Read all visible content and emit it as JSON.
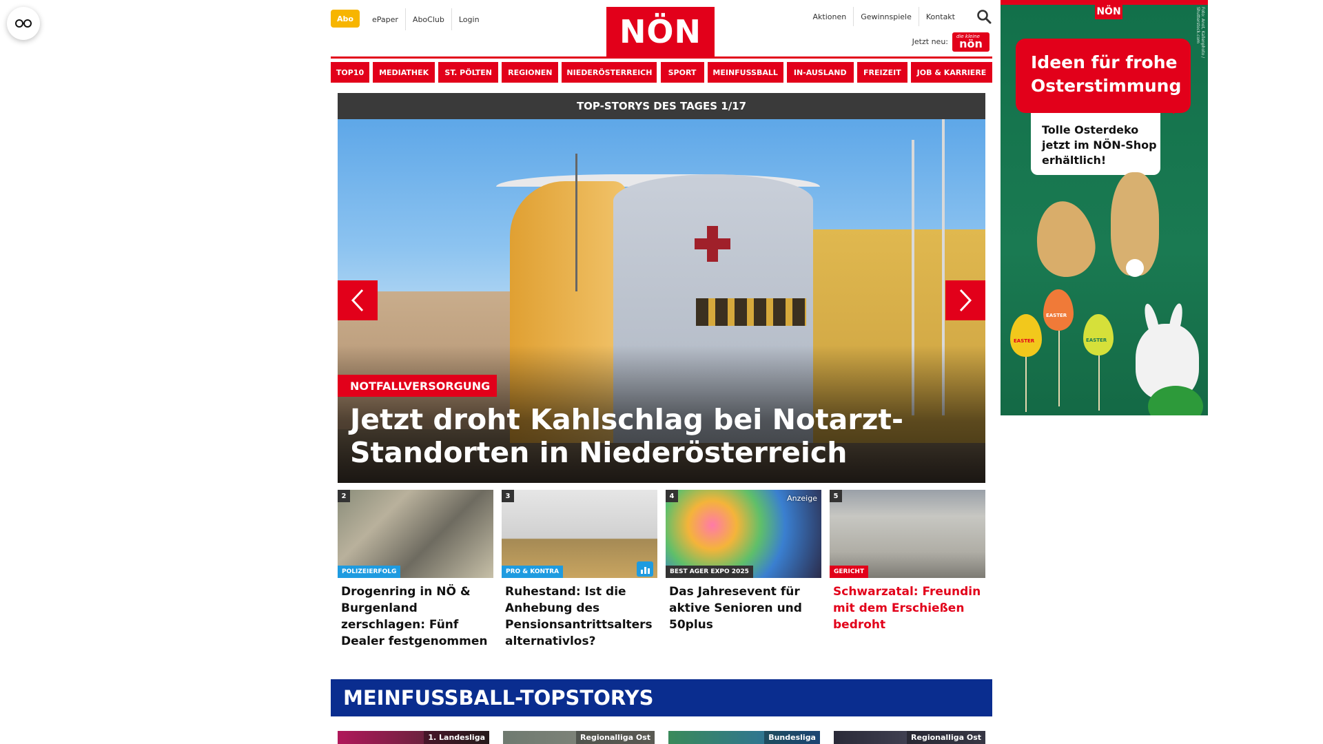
{
  "floating_button": {
    "icon": "glasses-icon"
  },
  "header": {
    "abo_label": "Abo",
    "left_links": [
      "ePaper",
      "AboClub",
      "Login"
    ],
    "logo_text": "NÖN",
    "right_links": [
      "Aktionen",
      "Gewinnspiele",
      "Kontakt"
    ],
    "jetzt_neu_label": "Jetzt neu:",
    "mini_badge_text": "nön",
    "mini_badge_script": "die kleine"
  },
  "nav": {
    "items": [
      "TOP10",
      "MEDIATHEK",
      "ST. PÖLTEN",
      "REGIONEN",
      "NIEDERÖSTERREICH",
      "SPORT",
      "MEINFUSSBALL",
      "IN-AUSLAND",
      "FREIZEIT",
      "JOB & KARRIERE"
    ]
  },
  "hero": {
    "header": "TOP-STORYS DES TAGES 1/17",
    "kicker": "NOTFALLVERSORGUNG",
    "title": "Jetzt droht Kahlschlag bei Notarzt-Standorten in Niederösterreich"
  },
  "cards": [
    {
      "num": "2",
      "tag": "POLIZEIERFOLG",
      "title": "Drogenring in NÖ & Burgenland zerschlagen: Fünf Dealer festgenommen"
    },
    {
      "num": "3",
      "tag": "PRO & KONTRA",
      "title": "Ruhestand: Ist die Anhebung des Pensionsantrittsalters alternativlos?"
    },
    {
      "num": "4",
      "tag": "BEST AGER EXPO 2025",
      "title": "Das Jahresevent für aktive Senioren und 50plus",
      "badge": "Anzeige"
    },
    {
      "num": "5",
      "tag": "GERICHT",
      "title": "Schwarzatal: Freundin mit dem Erschießen bedroht"
    }
  ],
  "fussball": {
    "header": "MEINFUSSBALL-TOPSTORYS",
    "leagues": [
      "1. Landesliga",
      "Regionalliga Ost",
      "Bundesliga",
      "Regionalliga Ost"
    ]
  },
  "ad": {
    "logo": "NÖN",
    "headline": "Ideen für frohe Osterstimmung",
    "note": "Tolle Osterdeko jetzt im NÖN-Shop erhältlich!",
    "credit": "Foto: Anot, Kallenphoto / Shutterstock.com",
    "egg_text": "EASTER"
  },
  "colors": {
    "brand_red": "#e2001a",
    "abo_yellow": "#f7b500",
    "fussball_blue": "#0a2d8f",
    "ad_green": "#1a7a52",
    "slider_header": "#3a3a3a"
  }
}
